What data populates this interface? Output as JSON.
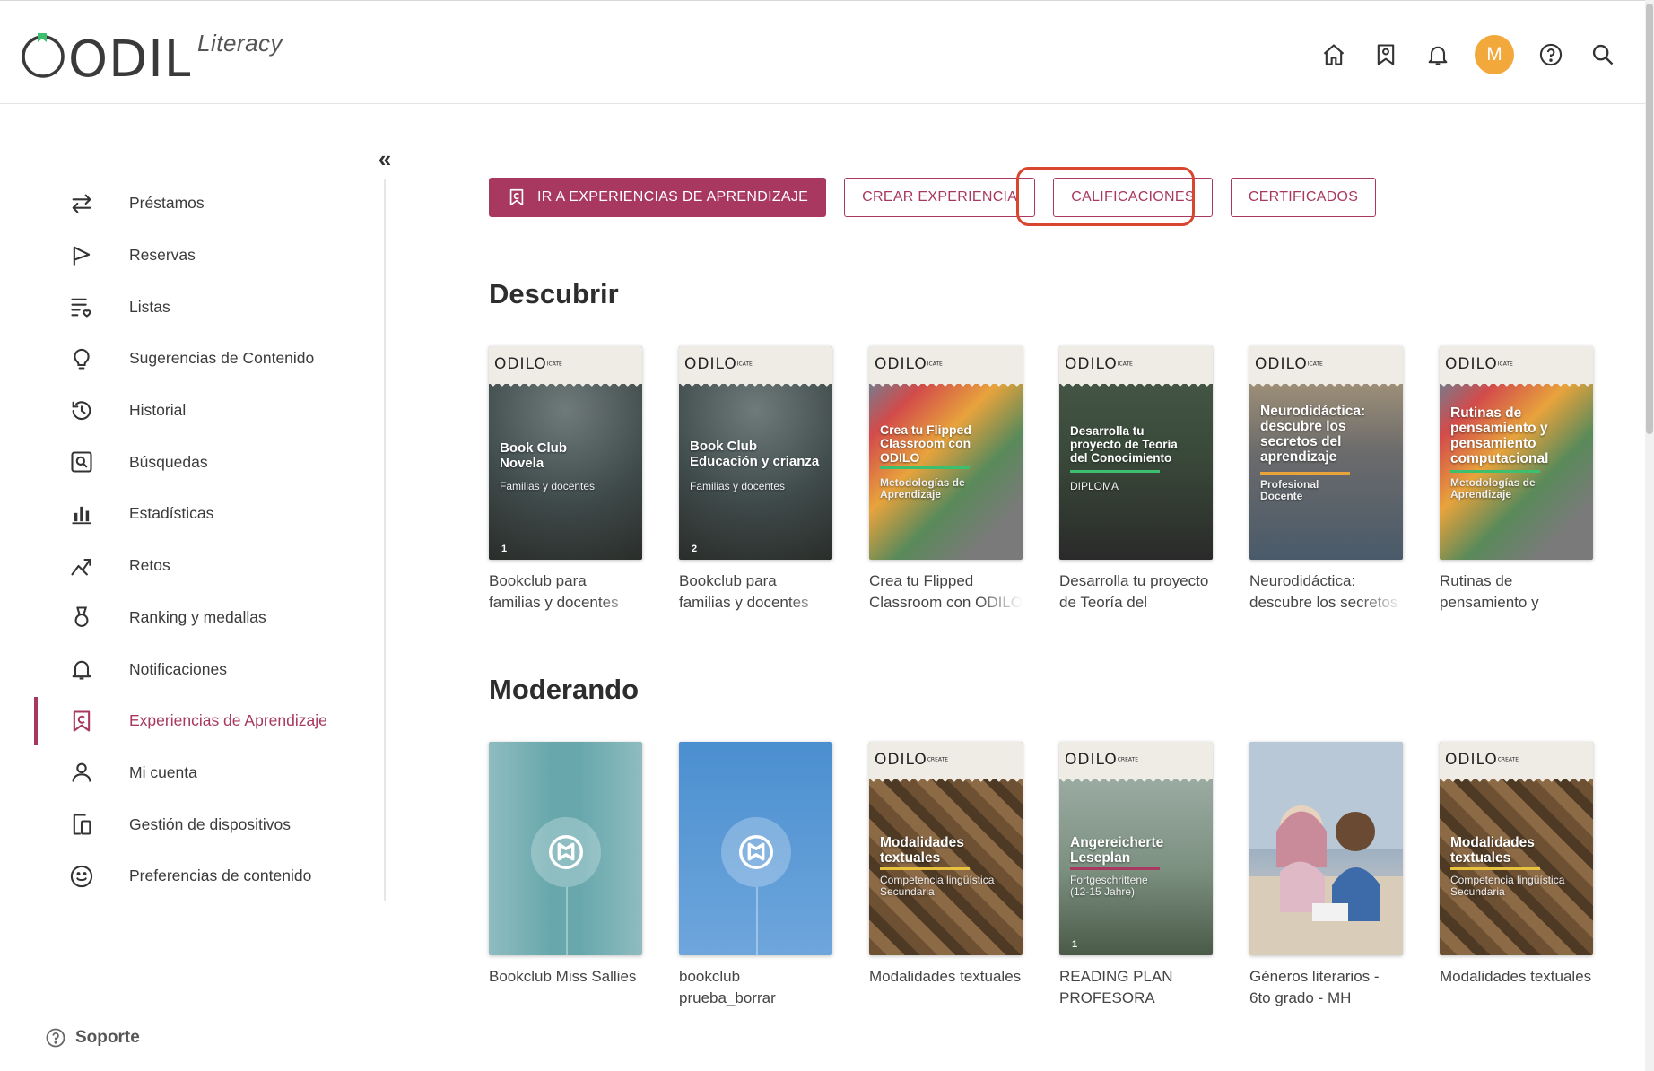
{
  "app": {
    "logo_text": "ODILO",
    "logo_sub": "Literacy",
    "brand_color": "#a8385f",
    "avatar_letter": "M",
    "avatar_color": "#f2a83b"
  },
  "header": {
    "icons": [
      "home-icon",
      "bookmark-icon",
      "bell-icon",
      "avatar",
      "help-icon",
      "search-icon"
    ]
  },
  "sidebar": {
    "items": [
      {
        "label": "Préstamos",
        "icon": "swap-arrows-icon"
      },
      {
        "label": "Reservas",
        "icon": "flag-icon"
      },
      {
        "label": "Listas",
        "icon": "list-heart-icon"
      },
      {
        "label": "Sugerencias de Contenido",
        "icon": "lightbulb-icon"
      },
      {
        "label": "Historial",
        "icon": "history-icon"
      },
      {
        "label": "Búsquedas",
        "icon": "search-box-icon"
      },
      {
        "label": "Estadísticas",
        "icon": "bar-chart-icon"
      },
      {
        "label": "Retos",
        "icon": "challenge-icon"
      },
      {
        "label": "Ranking y medallas",
        "icon": "medal-icon"
      },
      {
        "label": "Notificaciones",
        "icon": "bell-icon"
      },
      {
        "label": "Experiencias de Aprendizaje",
        "icon": "experience-icon",
        "active": true
      },
      {
        "label": "Mi cuenta",
        "icon": "user-icon"
      },
      {
        "label": "Gestión de dispositivos",
        "icon": "devices-icon"
      },
      {
        "label": "Preferencias de contenido",
        "icon": "smiley-icon"
      }
    ],
    "support_label": "Soporte"
  },
  "actions": {
    "go_label": "IR A EXPERIENCIAS DE APRENDIZAJE",
    "create_label": "CREAR EXPERIENCIA",
    "grades_label": "CALIFICACIONES",
    "certificates_label": "CERTIFICADOS"
  },
  "sections": {
    "discover": {
      "title": "Descubrir",
      "cards": [
        {
          "title": "Bookclub para familias y docentes",
          "cover_title": "Book Club\nNovela",
          "cover_sub": "Familias y docentes",
          "cover_num": "1",
          "brand": "ODILO",
          "brand_small": "ICATE"
        },
        {
          "title": "Bookclub para familias y docentes",
          "cover_title": "Book Club\nEducación y crianza",
          "cover_sub": "Familias y docentes",
          "cover_num": "2",
          "brand": "ODILO",
          "brand_small": "ICATE"
        },
        {
          "title": "Crea tu Flipped Classroom con ODILO",
          "cover_title": "Crea tu Flipped\nClassroom con\nODILO",
          "cover_sub": "Metodologías de\nAprendizaje",
          "brand": "ODILO",
          "brand_small": "ICATE"
        },
        {
          "title": "Desarrolla tu proyecto de Teoría del Conocimiento",
          "cover_title": "Desarrolla tu\nproyecto de Teoría\ndel Conocimiento",
          "cover_sub": "DIPLOMA",
          "brand": "ODILO",
          "brand_small": "ICATE"
        },
        {
          "title": "Neurodidáctica: descubre los secretos del aprendizaje",
          "cover_title": "Neurodidáctica:\ndescubre los\nsecretos del\naprendizaje",
          "cover_sub": "Profesional\nDocente",
          "brand": "ODILO",
          "brand_small": "ICATE"
        },
        {
          "title": "Rutinas de pensamiento y pensamiento computacional",
          "cover_title": "Rutinas de\npensamiento y\npensamiento\ncomputacional",
          "cover_sub": "Metodologías de\nAprendizaje",
          "brand": "ODILO",
          "brand_small": "ICATE"
        }
      ]
    },
    "moderating": {
      "title": "Moderando",
      "cards": [
        {
          "title": "Bookclub Miss Sallies"
        },
        {
          "title": "bookclub prueba_borrar"
        },
        {
          "title": "Modalidades textuales",
          "cover_title": "Modalidades\ntextuales",
          "cover_sub": "Competencia lingüística\nSecundaria",
          "brand": "ODILO",
          "brand_small": "CREATE"
        },
        {
          "title": "READING PLAN PROFESORA CARMEN",
          "cover_title": "Angereicherte\nLeseplan",
          "cover_sub": "Fortgeschrittene\n(12-15 Jahre)",
          "cover_num": "1",
          "brand": "ODILO",
          "brand_small": "CREATE"
        },
        {
          "title": "Géneros literarios - 6to grado - MH"
        },
        {
          "title": "Modalidades textuales",
          "cover_title": "Modalidades\ntextuales",
          "cover_sub": "Competencia lingüística\nSecundaria",
          "brand": "ODILO",
          "brand_small": "CREATE"
        }
      ]
    }
  }
}
